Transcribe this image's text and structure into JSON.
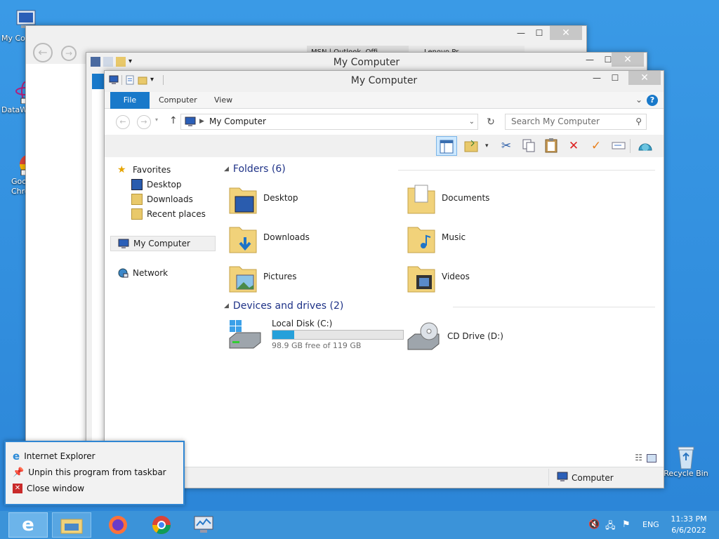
{
  "desktop": {
    "icons": [
      {
        "label": "My Co"
      },
      {
        "label": "DataW"
      },
      {
        "label": "Goo\nChro"
      },
      {
        "label": "Recycle Bin"
      }
    ]
  },
  "ie_window": {
    "tabs": [
      "MSN | Outlook, Offi",
      "Lenovo Pr"
    ]
  },
  "back_window": {
    "title": "My Computer"
  },
  "explorer": {
    "title": "My Computer",
    "ribbon_tabs": {
      "file": "File",
      "computer": "Computer",
      "view": "View"
    },
    "address": "My Computer",
    "search_placeholder": "Search My Computer",
    "nav": {
      "favorites": "Favorites",
      "desktop": "Desktop",
      "downloads": "Downloads",
      "recent": "Recent places",
      "my_computer": "My Computer",
      "network": "Network"
    },
    "folders_header": "Folders (6)",
    "folders": [
      {
        "name": "Desktop"
      },
      {
        "name": "Documents"
      },
      {
        "name": "Downloads"
      },
      {
        "name": "Music"
      },
      {
        "name": "Pictures"
      },
      {
        "name": "Videos"
      }
    ],
    "devices_header": "Devices and drives (2)",
    "local_disk": {
      "name": "Local Disk (C:)",
      "free": "98.9 GB free of 119 GB",
      "used_fraction": 0.169
    },
    "cd_drive": {
      "name": "CD Drive (D:)"
    },
    "status_right": "Computer"
  },
  "jumplist": {
    "items": [
      "Internet Explorer",
      "Unpin this program from taskbar",
      "Close window"
    ]
  },
  "tray": {
    "lang": "ENG",
    "time": "11:33 PM",
    "date": "6/6/2022"
  },
  "colors": {
    "accent": "#1979ca",
    "taskbar": "#3b93d9",
    "progress": "#26a0da"
  }
}
